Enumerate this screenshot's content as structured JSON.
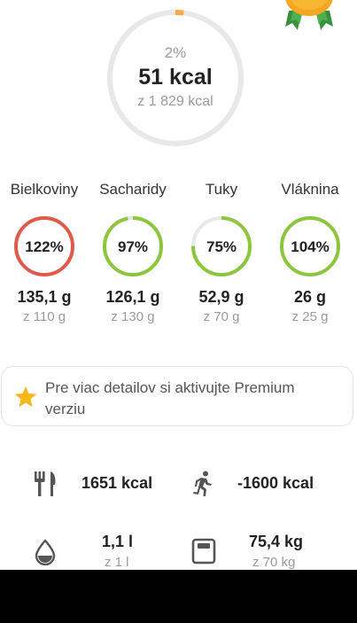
{
  "calories": {
    "percent": "2%",
    "value": "51 kcal",
    "goal": "z 1 829 kcal",
    "progress": 0.02,
    "track_color": "#e6e8ea",
    "progress_color": "#f5a84a"
  },
  "badge": {
    "icon": "medal-icon",
    "colors": [
      "#f5a623",
      "#4caf50"
    ]
  },
  "macros": [
    {
      "name": "Bielkoviny",
      "percent": "122%",
      "amount": "135,1 g",
      "goal": "z 110 g",
      "progress": 1.22,
      "color": "#e05a4b"
    },
    {
      "name": "Sacharidy",
      "percent": "97%",
      "amount": "126,1 g",
      "goal": "z 130 g",
      "progress": 0.97,
      "color": "#8cc63f"
    },
    {
      "name": "Tuky",
      "percent": "75%",
      "amount": "52,9 g",
      "goal": "z 70 g",
      "progress": 0.75,
      "color": "#8cc63f"
    },
    {
      "name": "Vláknina",
      "percent": "104%",
      "amount": "26 g",
      "goal": "z 25 g",
      "progress": 1.04,
      "color": "#8cc63f"
    }
  ],
  "premium": {
    "text": "Pre viac detailov si aktivujte Premium verziu",
    "icon": "star-icon",
    "star_color": "#f5b81c"
  },
  "stats": {
    "food": {
      "icon": "cutlery-icon",
      "value": "1651 kcal"
    },
    "exercise": {
      "icon": "running-icon",
      "value": "-1600 kcal"
    },
    "water": {
      "icon": "water-drop-icon",
      "value": "1,1 l",
      "goal": "z 1 l"
    },
    "weight": {
      "icon": "scale-icon",
      "value": "75,4 kg",
      "goal": "z 70 kg"
    }
  }
}
